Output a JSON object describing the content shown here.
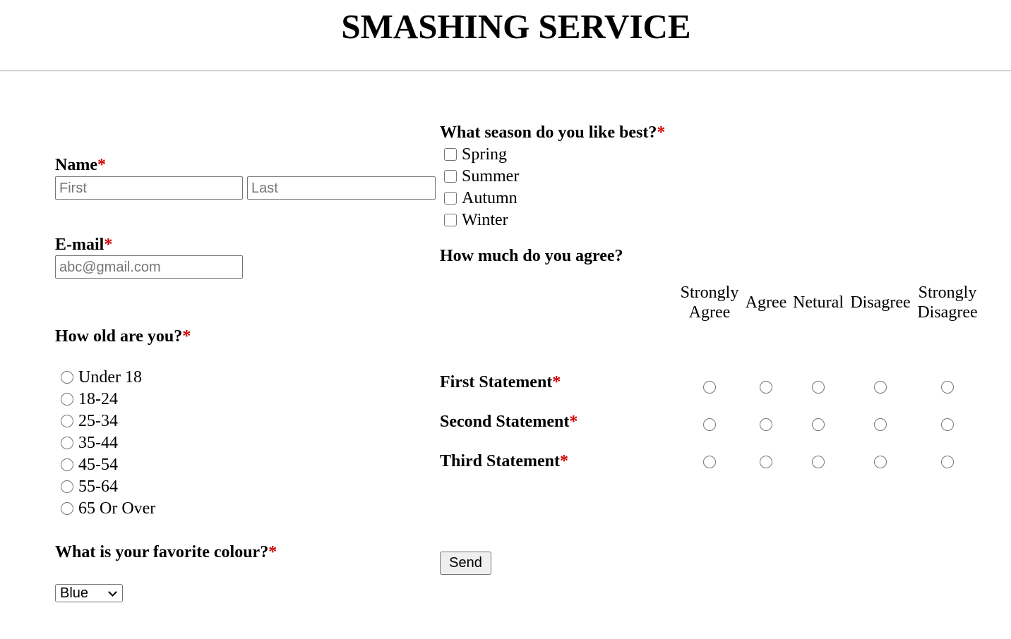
{
  "header": {
    "title": "SMASHING SERVICE"
  },
  "required_mark": "*",
  "name": {
    "label": "Name",
    "first_placeholder": "First",
    "last_placeholder": "Last"
  },
  "email": {
    "label": "E-mail",
    "placeholder": "abc@gmail.com"
  },
  "age": {
    "label": "How old are you?",
    "options": [
      "Under 18",
      "18-24",
      "25-34",
      "35-44",
      "45-54",
      "55-64",
      "65 Or Over"
    ]
  },
  "colour": {
    "label": "What is your favorite colour?",
    "selected": "Blue"
  },
  "season": {
    "label": "What season do you like best?",
    "options": [
      "Spring",
      "Summer",
      "Autumn",
      "Winter"
    ]
  },
  "agree": {
    "label": "How much do you agree?",
    "columns": [
      "Strongly Agree",
      "Agree",
      "Netural",
      "Disagree",
      "Strongly Disagree"
    ],
    "column_lines": [
      [
        "Strongly",
        "Agree"
      ],
      [
        "Agree"
      ],
      [
        "Netural"
      ],
      [
        "Disagree"
      ],
      [
        "Strongly",
        "Disagree"
      ]
    ],
    "statements": [
      "First Statement",
      "Second Statement",
      "Third Statement"
    ]
  },
  "send_label": "Send"
}
